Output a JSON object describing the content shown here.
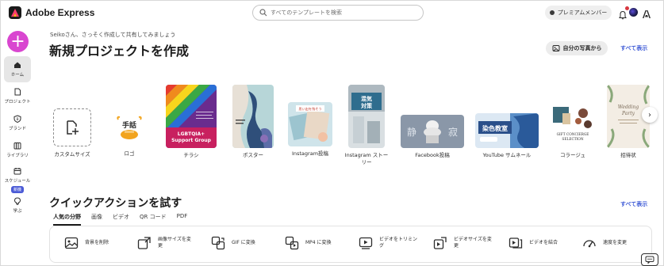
{
  "app": {
    "title": "Adobe Express"
  },
  "search": {
    "placeholder": "すべてのテンプレートを検索"
  },
  "header": {
    "premium_label": "プレミアムメンバー"
  },
  "colors": {
    "accent": "#3d5ad6",
    "create": "#d946d0",
    "new_badge": "#4b5bd6"
  },
  "nav": {
    "items": [
      {
        "label": "ホーム",
        "icon": "home-icon"
      },
      {
        "label": "プロジェクト",
        "icon": "document-icon"
      },
      {
        "label": "ブランド",
        "icon": "brand-icon"
      },
      {
        "label": "ライブラリ",
        "icon": "library-icon"
      },
      {
        "label": "スケジュール",
        "icon": "calendar-icon",
        "badge": "新機"
      },
      {
        "label": "学ぶ",
        "icon": "lightbulb-icon"
      }
    ]
  },
  "main": {
    "greeting": "Seikoさん、さっそく作成して共有してみましょう",
    "title": "新規プロジェクトを作成",
    "photos_button": "自分の写真から",
    "see_all": "すべて表示",
    "templates": [
      {
        "label": "カスタムサイズ"
      },
      {
        "label": "ロゴ",
        "thumb_text": "手話"
      },
      {
        "label": "チラシ",
        "thumb_text": "LGBTQIA+\nSupport Group"
      },
      {
        "label": "ポスター"
      },
      {
        "label": "Instagram投稿",
        "thumb_text": "思い出を残そう"
      },
      {
        "label": "Instagram ストーリー",
        "thumb_text": "混気対策"
      },
      {
        "label": "Facebook投稿",
        "thumb_text": "静 寂"
      },
      {
        "label": "YouTube サムネール",
        "thumb_text": "染色教室"
      },
      {
        "label": "コラージュ",
        "thumb_text": "GIFT CONCIERGE SELECTION"
      },
      {
        "label": "招待状",
        "thumb_text": "Wedding Party"
      }
    ]
  },
  "quick_actions": {
    "title": "クイックアクションを試す",
    "see_all": "すべて表示",
    "tabs": [
      "人気の分野",
      "画像",
      "ビデオ",
      "QR コード",
      "PDF"
    ],
    "items": [
      {
        "label": "背景を削除",
        "icon": "remove-background-icon"
      },
      {
        "label": "画像サイズを変更",
        "icon": "resize-image-icon"
      },
      {
        "label": "GIF に変換",
        "icon": "gif-convert-icon"
      },
      {
        "label": "MP4 に変換",
        "icon": "mp4-convert-icon"
      },
      {
        "label": "ビデオをトリミング",
        "icon": "trim-video-icon"
      },
      {
        "label": "ビデオサイズを変更",
        "icon": "resize-video-icon"
      },
      {
        "label": "ビデオを結合",
        "icon": "merge-video-icon"
      },
      {
        "label": "速度を変更",
        "icon": "speed-icon"
      }
    ]
  }
}
